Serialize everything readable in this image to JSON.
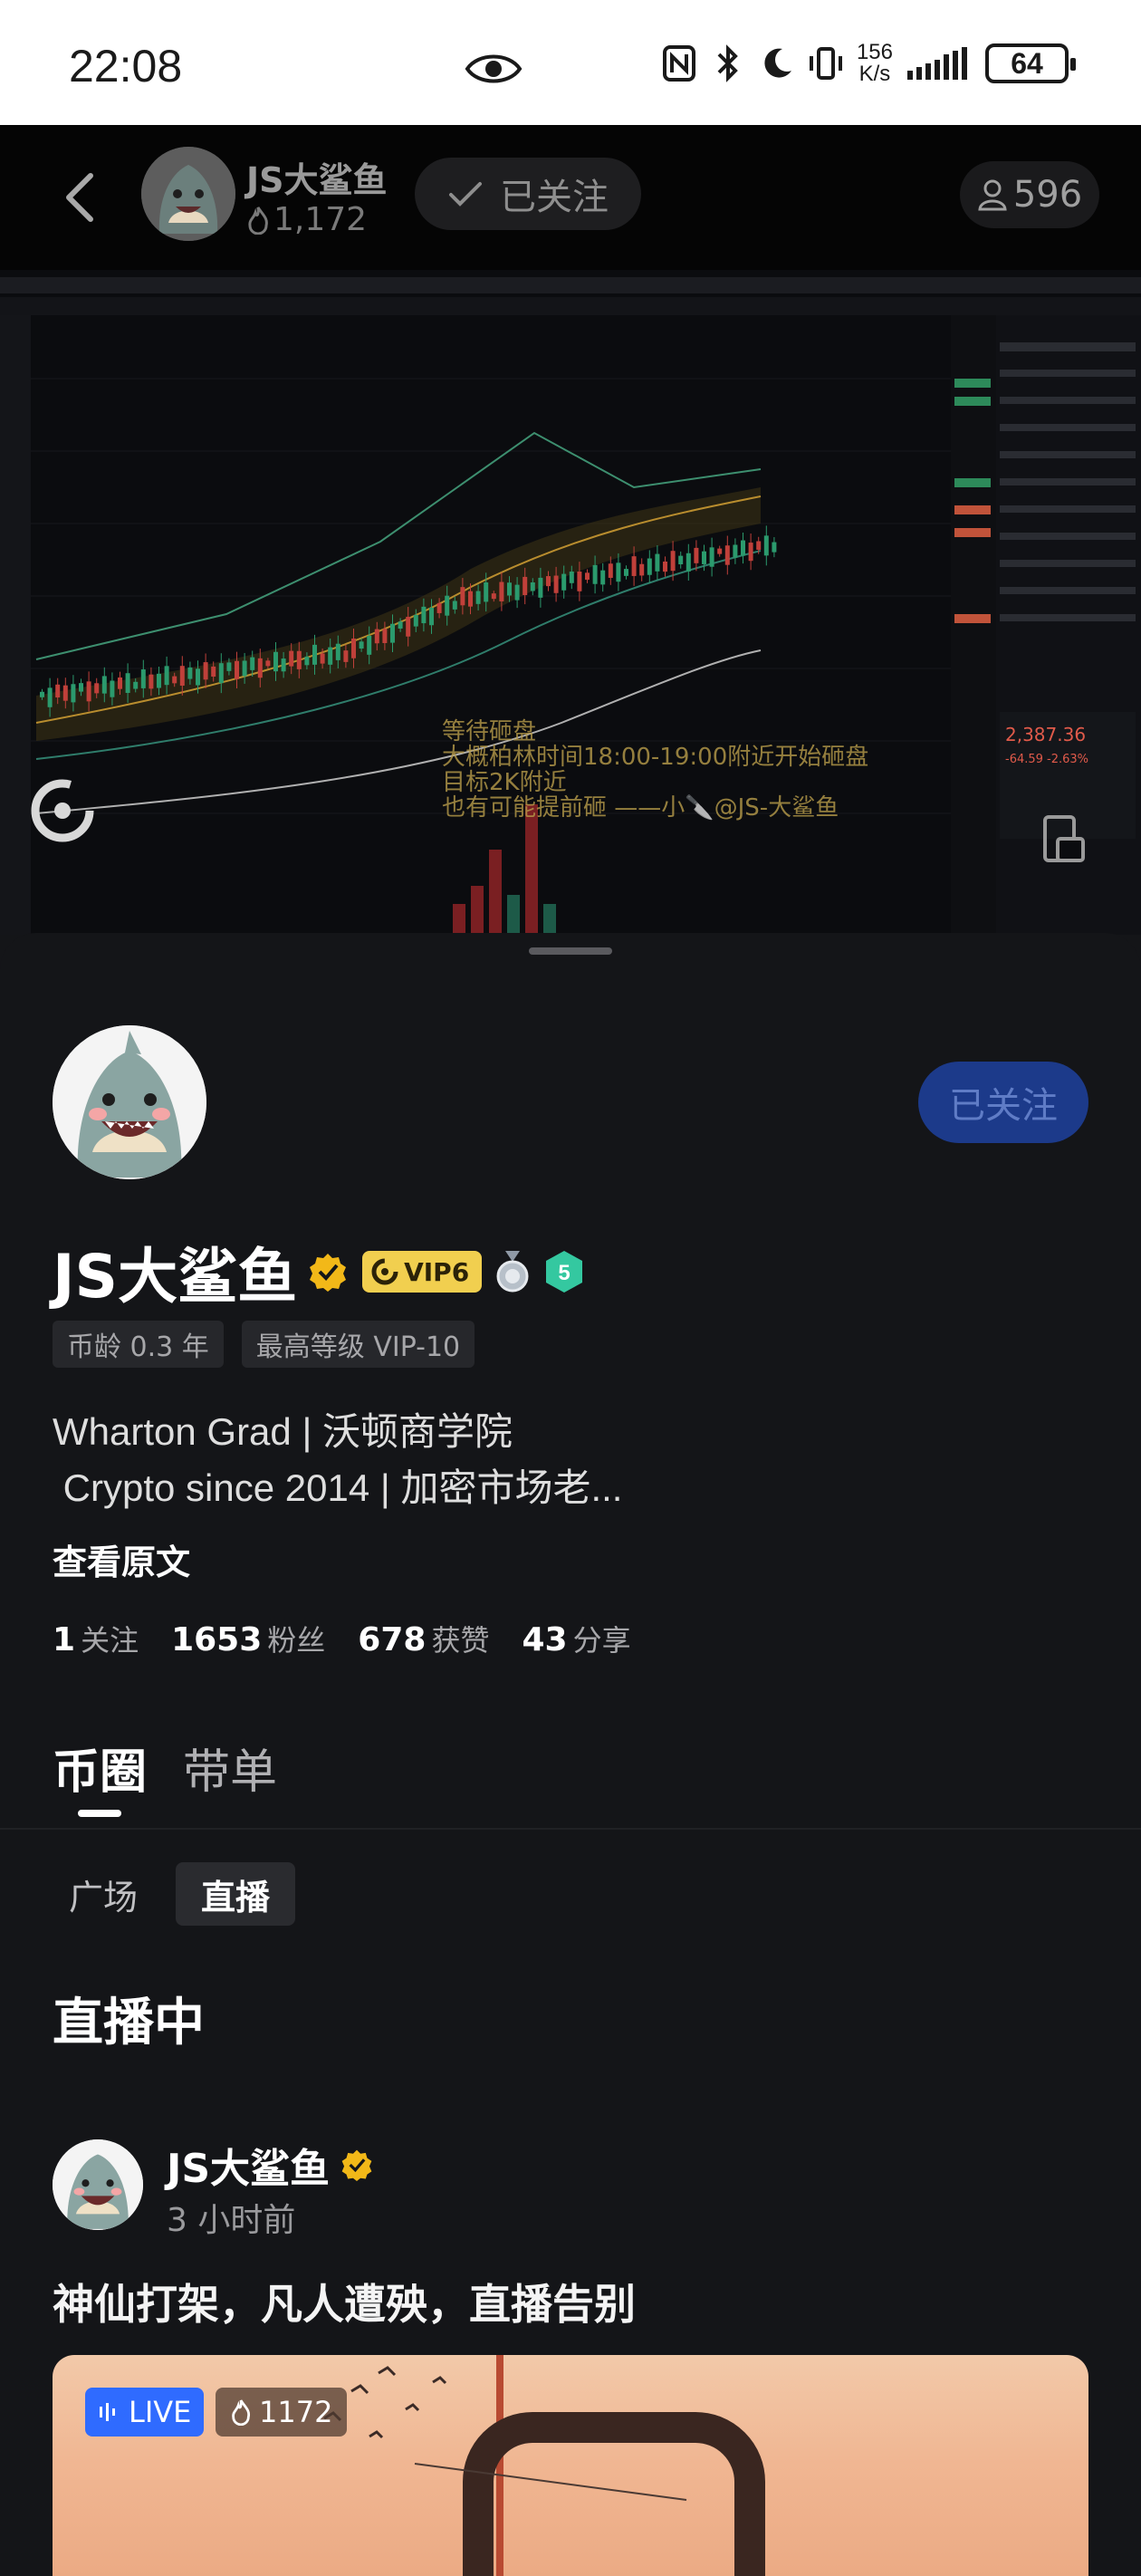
{
  "status_bar": {
    "time": "22:08",
    "speed_value": "156",
    "speed_unit": "K/s",
    "battery": "64",
    "icons": [
      "eye-icon",
      "nfc-icon",
      "bluetooth-icon",
      "moon-icon",
      "vibrate-icon",
      "signal-icon",
      "battery-icon"
    ]
  },
  "top_nav": {
    "name": "JS大鲨鱼",
    "heat": "1,172",
    "follow_label": "已关注",
    "viewers": "596"
  },
  "video": {
    "overlay_lines": [
      "等待砸盘",
      "大概柏林时间18:00-19:00附近开始砸盘",
      "目标2K附近",
      "也有可能提前砸 ——小🔪@JS-大鲨鱼"
    ],
    "price": "2,387.36",
    "change": "-64.59 -2.63%"
  },
  "profile": {
    "name": "JS大鲨鱼",
    "vip_label": "VIP6",
    "level": "5",
    "follow_label": "已关注",
    "tags": [
      "币龄 0.3 年",
      "最高等级 VIP-10"
    ],
    "bio_line1": "Wharton Grad | 沃顿商学院",
    "bio_line2": " Crypto since 2014 | 加密市场老...",
    "view_original": "查看原文",
    "stats": [
      {
        "num": "1",
        "label": "关注"
      },
      {
        "num": "1653",
        "label": "粉丝"
      },
      {
        "num": "678",
        "label": "获赞"
      },
      {
        "num": "43",
        "label": "分享"
      }
    ]
  },
  "tabs": [
    "币圈",
    "带单"
  ],
  "subtabs": [
    "广场",
    "直播"
  ],
  "section_title": "直播中",
  "post": {
    "author": "JS大鲨鱼",
    "time": "3 小时前",
    "title": "神仙打架，凡人遭殃，直播告别",
    "live_label": "LIVE",
    "heat": "1172"
  },
  "colors": {
    "background": "#141518",
    "accent_blue": "#2f6bff",
    "vip_gold": "#f1cf4f",
    "verified_gold": "#f2b818",
    "follow_button": "#1c3a8a"
  }
}
